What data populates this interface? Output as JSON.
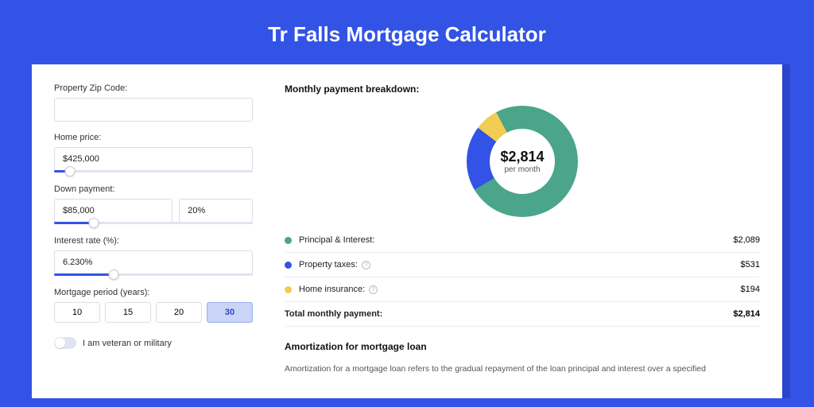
{
  "title": "Tr Falls Mortgage Calculator",
  "form": {
    "zip": {
      "label": "Property Zip Code:",
      "value": ""
    },
    "homePrice": {
      "label": "Home price:",
      "value": "$425,000",
      "sliderPercent": 8
    },
    "downPayment": {
      "label": "Down payment:",
      "value": "$85,000",
      "percent": "20%",
      "sliderPercent": 20
    },
    "interestRate": {
      "label": "Interest rate (%):",
      "value": "6.230%",
      "sliderPercent": 30
    },
    "period": {
      "label": "Mortgage period (years):",
      "options": [
        "10",
        "15",
        "20",
        "30"
      ],
      "selected": "30"
    },
    "veteran": {
      "label": "I am veteran or military",
      "on": false
    }
  },
  "breakdown": {
    "title": "Monthly payment breakdown:",
    "amount": "$2,814",
    "amountSub": "per month",
    "items": [
      {
        "label": "Principal & Interest:",
        "value": "$2,089",
        "color": "#4aa58a",
        "info": false
      },
      {
        "label": "Property taxes:",
        "value": "$531",
        "color": "#3353e6",
        "info": true
      },
      {
        "label": "Home insurance:",
        "value": "$194",
        "color": "#f2cc53",
        "info": true
      }
    ],
    "totalLabel": "Total monthly payment:",
    "totalValue": "$2,814"
  },
  "chart_data": {
    "type": "pie",
    "title": "Monthly payment breakdown",
    "series": [
      {
        "name": "Principal & Interest",
        "value": 2089,
        "color": "#4aa58a"
      },
      {
        "name": "Property taxes",
        "value": 531,
        "color": "#3353e6"
      },
      {
        "name": "Home insurance",
        "value": 194,
        "color": "#f2cc53"
      }
    ],
    "total": 2814,
    "centerLabel": "$2,814",
    "centerSub": "per month"
  },
  "amortization": {
    "title": "Amortization for mortgage loan",
    "text": "Amortization for a mortgage loan refers to the gradual repayment of the loan principal and interest over a specified"
  }
}
